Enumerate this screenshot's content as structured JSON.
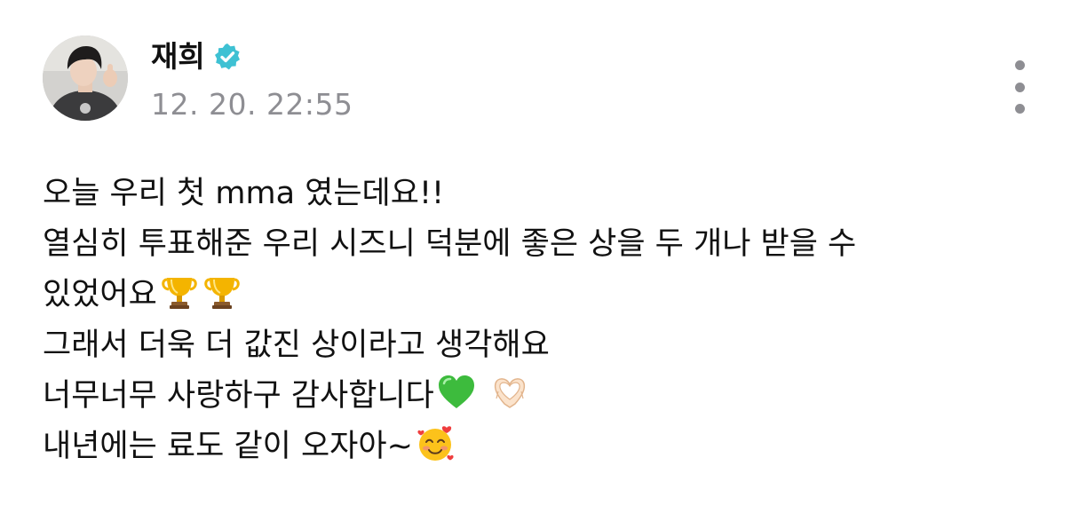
{
  "post": {
    "author": {
      "name": "재희",
      "verified": true,
      "verified_color": "#3ec1d3"
    },
    "timestamp": "12. 20. 22:55",
    "lines": [
      "오늘 우리 첫 mma 였는데요!!",
      "열심히 투표해준 우리 시즈니 덕분에 좋은 상을 두 개나 받을 수",
      "있었어요",
      "그래서 더욱 더 값진 상이라고 생각해요",
      "너무너무 사랑하구 감사합니다",
      "내년에는 료도 같이 오자아~"
    ],
    "emojis": {
      "line3": [
        "trophy-icon",
        "trophy-icon"
      ],
      "line5": [
        "green-heart-icon",
        "heart-hands-icon"
      ],
      "line6": [
        "smiling-face-with-hearts-icon"
      ]
    }
  },
  "colors": {
    "text": "#111111",
    "muted": "#8e8e93",
    "verified_badge": "#3ec1d3"
  }
}
